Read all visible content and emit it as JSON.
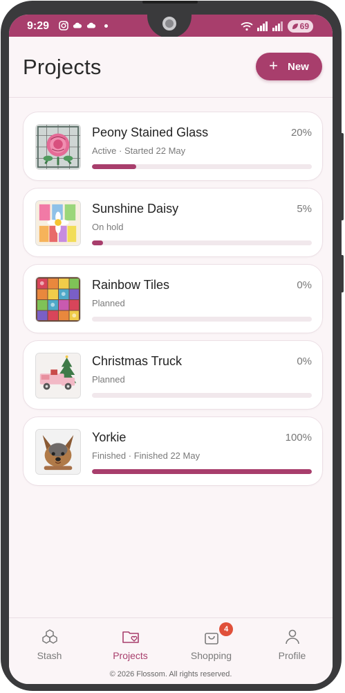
{
  "status_bar": {
    "time": "9:29",
    "battery": "69"
  },
  "header": {
    "title": "Projects",
    "new_label": "New"
  },
  "projects": [
    {
      "name": "Peony Stained Glass",
      "percent_label": "20%",
      "progress": 0.2,
      "status": "Active",
      "detail": "· Started 22 May",
      "thumb_icon": "peony-stained-glass-thumbnail"
    },
    {
      "name": "Sunshine Daisy",
      "percent_label": "5%",
      "progress": 0.05,
      "status": "On hold",
      "detail": "",
      "thumb_icon": "sunshine-daisy-thumbnail"
    },
    {
      "name": "Rainbow Tiles",
      "percent_label": "0%",
      "progress": 0.0,
      "status": "Planned",
      "detail": "",
      "thumb_icon": "rainbow-tiles-thumbnail"
    },
    {
      "name": "Christmas Truck",
      "percent_label": "0%",
      "progress": 0.0,
      "status": "Planned",
      "detail": "",
      "thumb_icon": "christmas-truck-thumbnail"
    },
    {
      "name": "Yorkie",
      "percent_label": "100%",
      "progress": 1.0,
      "status": "Finished",
      "detail": "· Finished 22 May",
      "thumb_icon": "yorkie-thumbnail"
    }
  ],
  "nav": {
    "items": [
      {
        "label": "Stash",
        "icon": "cubes-icon"
      },
      {
        "label": "Projects",
        "icon": "folder-heart-icon"
      },
      {
        "label": "Shopping",
        "icon": "shopping-bag-icon",
        "badge": "4"
      },
      {
        "label": "Profile",
        "icon": "person-icon"
      }
    ],
    "active": "Projects"
  },
  "footer": {
    "text": "© 2026 Flossom. All rights reserved."
  },
  "colors": {
    "accent": "#a83e6c",
    "background": "#fbf5f7",
    "badge": "#e0503a"
  }
}
